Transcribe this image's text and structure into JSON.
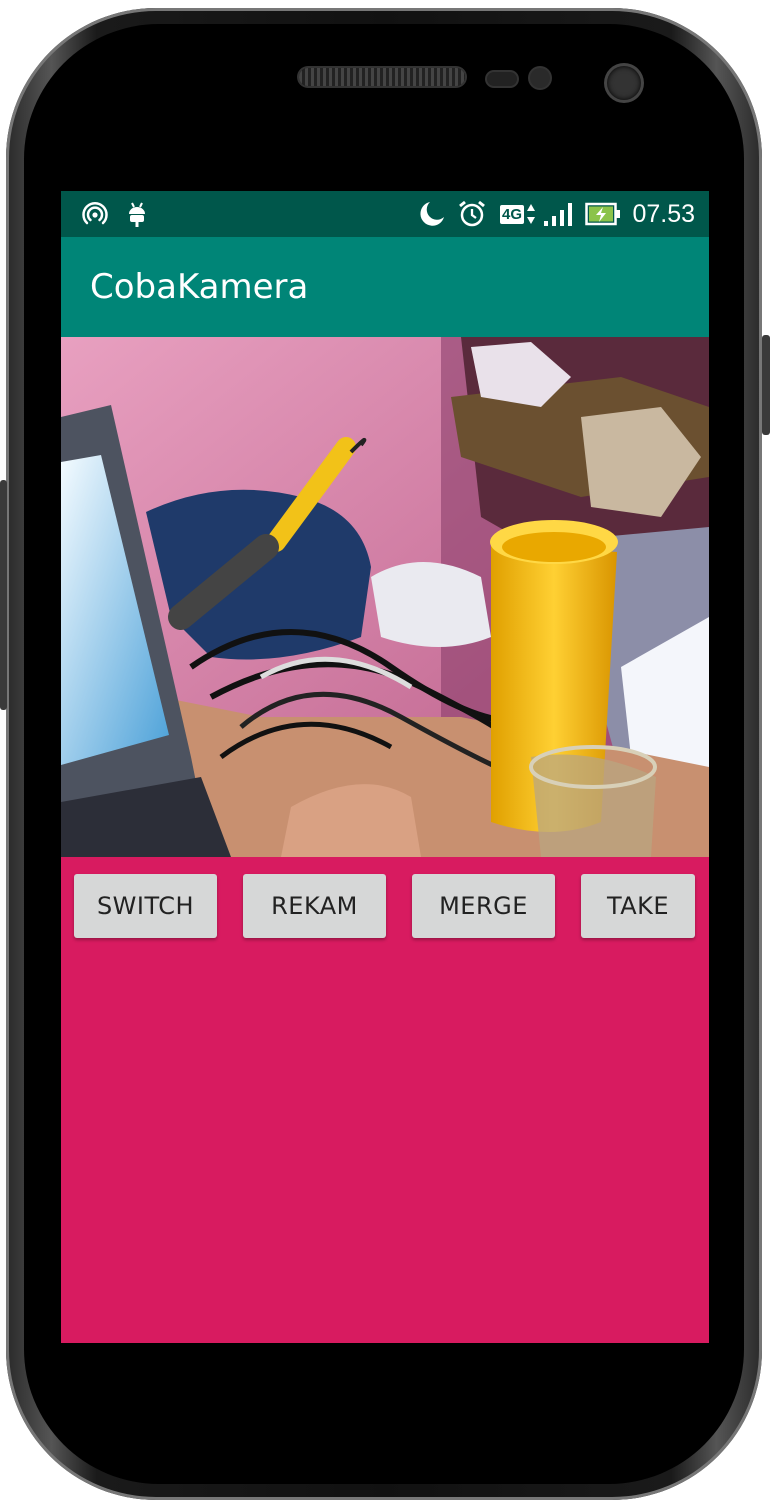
{
  "status_bar": {
    "time": "07.53",
    "network_label": "4G",
    "icons": [
      "hotspot-icon",
      "android-debug-icon",
      "moon-icon",
      "alarm-icon",
      "network-4g-icon",
      "signal-icon",
      "battery-charging-icon"
    ]
  },
  "app_bar": {
    "title": "CobaKamera",
    "color": "#008577",
    "status_color": "#00574b"
  },
  "camera_preview": {
    "description_icon": "camera-preview"
  },
  "buttons": {
    "switch_label": "SWITCH",
    "rekam_label": "REKAM",
    "merge_label": "MERGE",
    "take_label": "TAKE"
  },
  "colors": {
    "background": "#d81b60",
    "button": "#d6d7d7"
  }
}
